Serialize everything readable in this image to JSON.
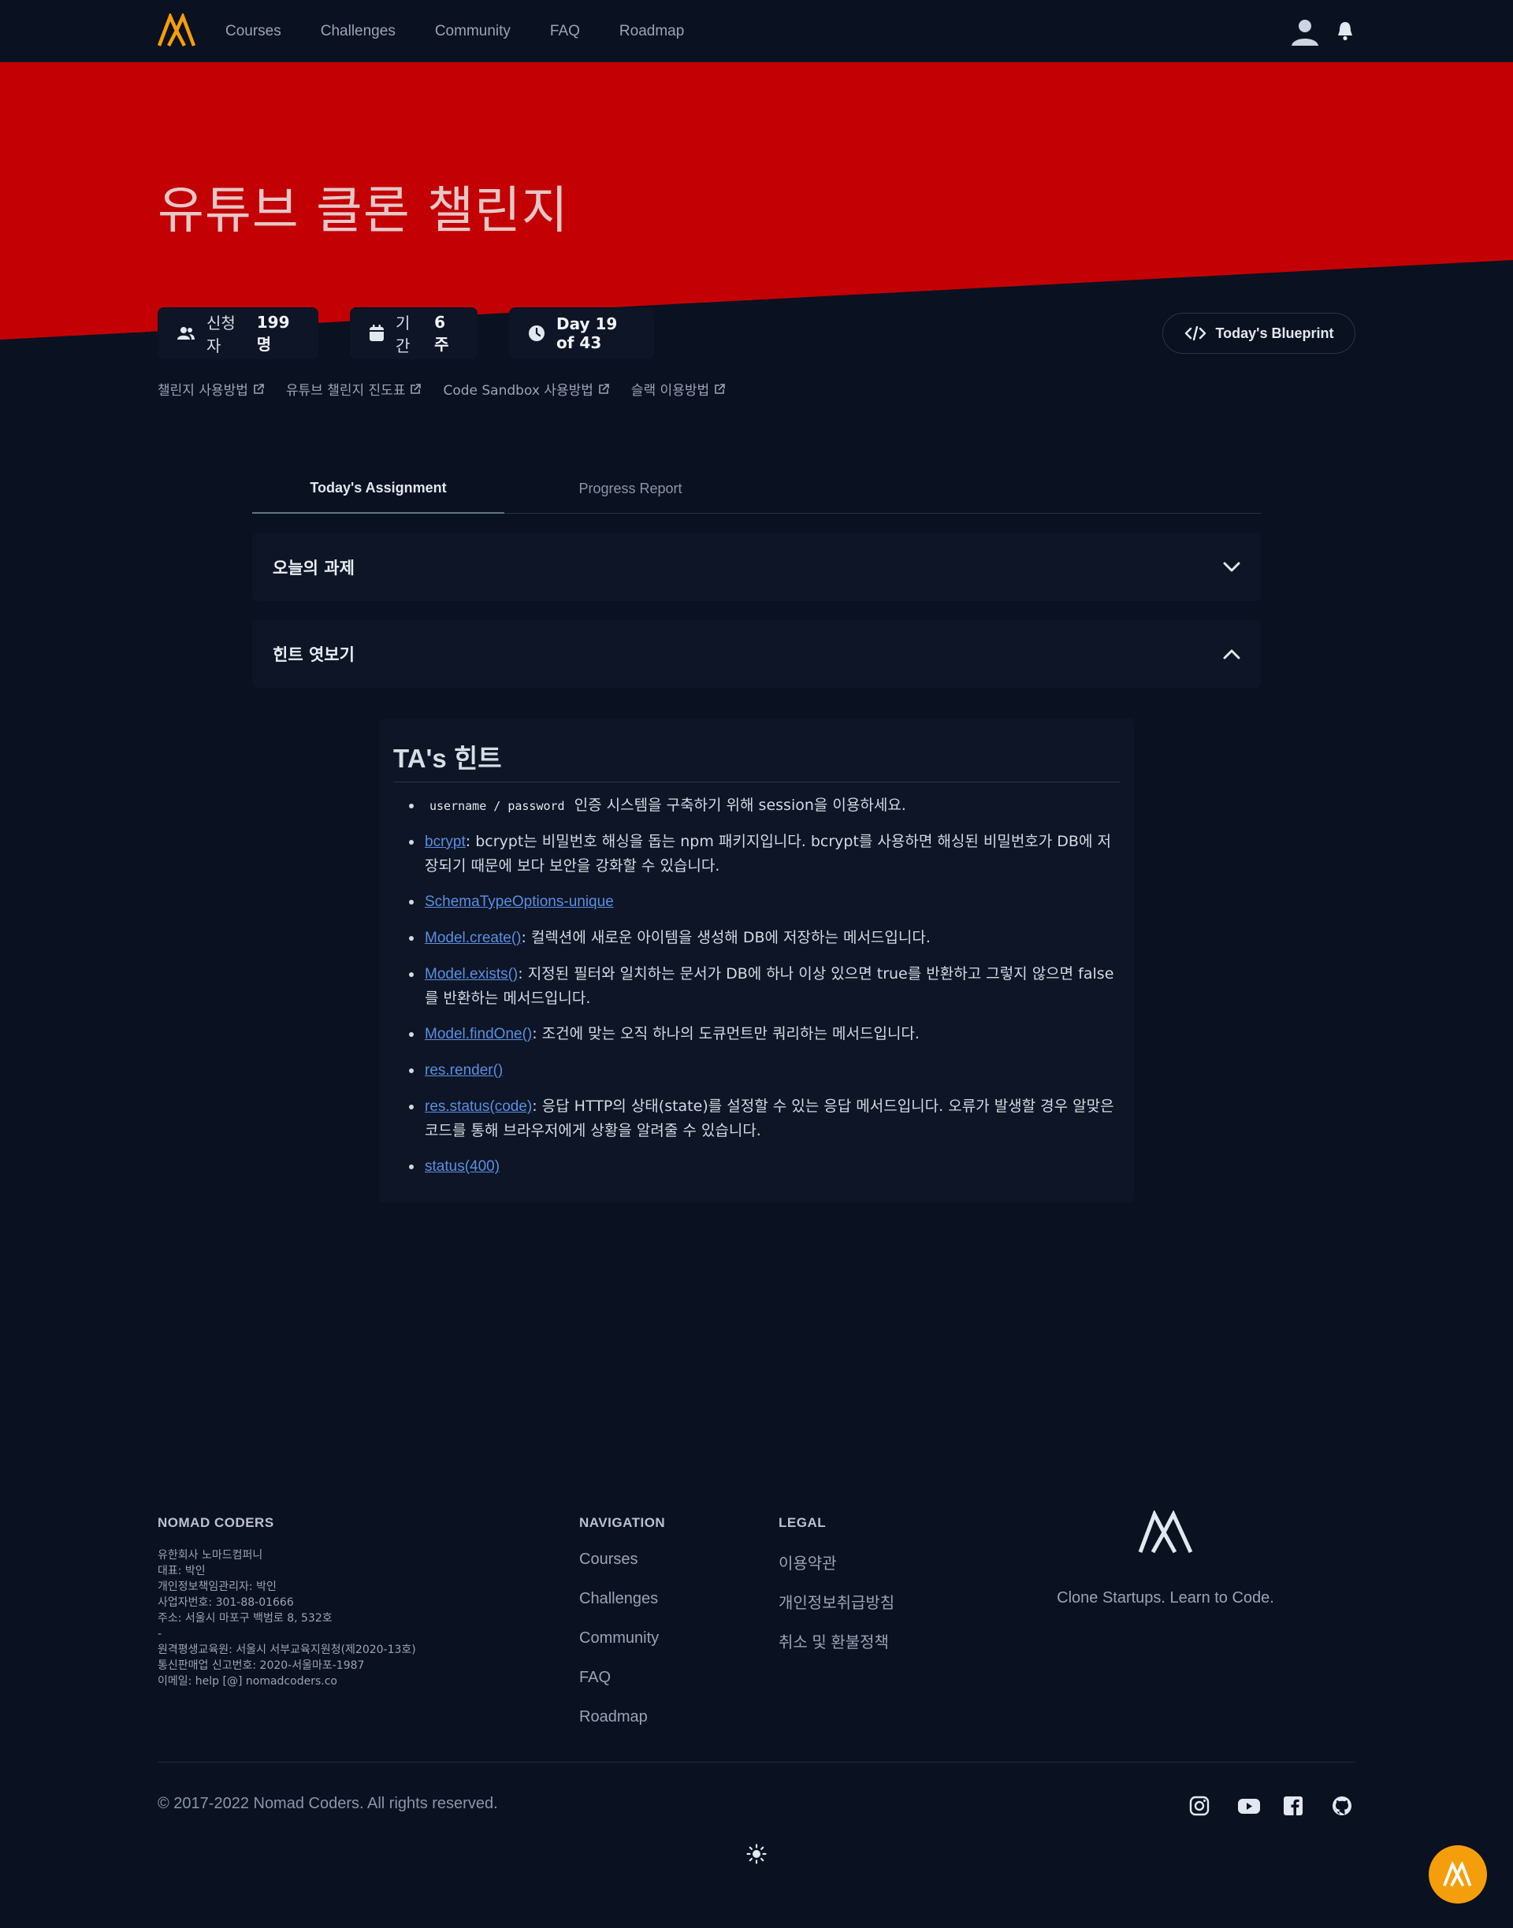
{
  "nav": {
    "items": [
      "Courses",
      "Challenges",
      "Community",
      "FAQ",
      "Roadmap"
    ]
  },
  "hero": {
    "title": "유튜브 클론 챌린지"
  },
  "stats": {
    "applicants_label": "신청자",
    "applicants_value": "199명",
    "duration_label": "기간",
    "duration_value": "6주",
    "day": "Day 19 of 43",
    "blueprint": "Today's Blueprint"
  },
  "links": [
    "챌린지 사용방법",
    "유튜브 챌린지 진도표",
    "Code Sandbox 사용방법",
    "슬랙 이용방법"
  ],
  "tabs": {
    "active": "Today's Assignment",
    "inactive": "Progress Report"
  },
  "accordion": {
    "assignment": "오늘의 과제",
    "hints": "힌트 엿보기"
  },
  "hint": {
    "title": "TA's 힌트",
    "items": [
      {
        "code": "username / password",
        "text": " 인증 시스템을 구축하기 위해 session을 이용하세요."
      },
      {
        "link": "bcrypt",
        "text": ": bcrypt는 비밀번호 해싱을 돕는 npm 패키지입니다. bcrypt를 사용하면 해싱된 비밀번호가 DB에 저장되기 때문에 보다 보안을 강화할 수 있습니다."
      },
      {
        "link": "SchemaTypeOptions-unique",
        "text": ""
      },
      {
        "link": "Model.create()",
        "text": ": 컬렉션에 새로운 아이템을 생성해 DB에 저장하는 메서드입니다."
      },
      {
        "link": "Model.exists()",
        "text": ": 지정된 필터와 일치하는 문서가 DB에 하나 이상 있으면 true를 반환하고 그렇지 않으면 false를 반환하는 메서드입니다."
      },
      {
        "link": "Model.findOne()",
        "text": ": 조건에 맞는 오직 하나의 도큐먼트만 쿼리하는 메서드입니다."
      },
      {
        "link": "res.render()",
        "text": ""
      },
      {
        "link": "res.status(code)",
        "text": ": 응답 HTTP의 상태(state)를 설정할 수 있는 응답 메서드입니다. 오류가 발생할 경우 알맞은 코드를 통해 브라우저에게 상황을 알려줄 수 있습니다."
      },
      {
        "link": "status(400)",
        "text": ""
      }
    ]
  },
  "footer": {
    "company_heading": "NOMAD CODERS",
    "company_lines": [
      "유한회사 노마드컴퍼니",
      "대표: 박인",
      "개인정보책임관리자: 박인",
      "사업자번호: 301-88-01666",
      "주소: 서울시 마포구 백범로 8, 532호",
      "-",
      "원격평생교육원: 서울시 서부교육지원청(제2020-13호)",
      "통신판매업 신고번호: 2020-서울마포-1987",
      "이메일: help [@] nomadcoders.co"
    ],
    "nav_heading": "NAVIGATION",
    "nav_items": [
      "Courses",
      "Challenges",
      "Community",
      "FAQ",
      "Roadmap"
    ],
    "legal_heading": "LEGAL",
    "legal_items": [
      "이용약관",
      "개인정보취급방침",
      "취소 및 환불정책"
    ],
    "tagline": "Clone Startups. Learn to Code.",
    "copyright": "© 2017-2022 Nomad Coders. All rights reserved."
  },
  "colors": {
    "background": "#0a1120",
    "hero_red": "#c30003",
    "logo_orange": "#f59e0b",
    "link_blue": "#5b8fe0"
  },
  "icons": [
    "logo-icon",
    "user-icon",
    "bell-icon",
    "users-icon",
    "calendar-icon",
    "clock-icon",
    "code-icon",
    "external-link-icon",
    "chevron-down-icon",
    "chevron-up-icon",
    "instagram-icon",
    "youtube-icon",
    "facebook-icon",
    "github-icon",
    "sun-icon"
  ]
}
